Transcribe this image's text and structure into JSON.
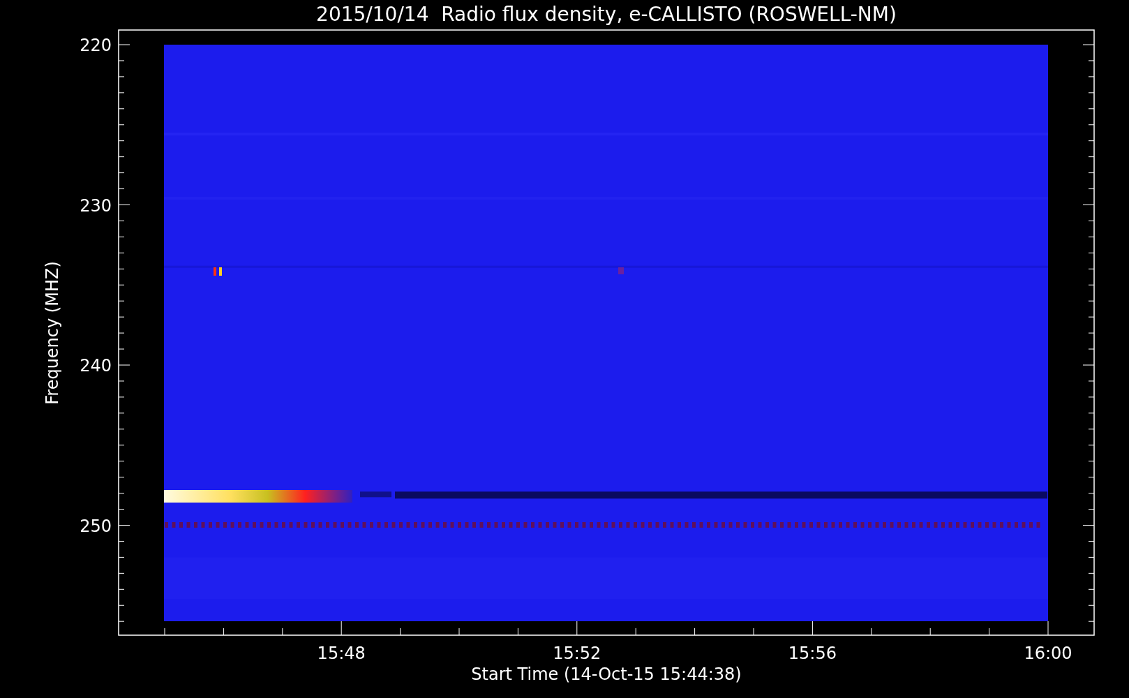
{
  "chart": {
    "title": "2015/10/14  Radio flux density, e-CALLISTO (ROSWELL-NM)",
    "xlabel": "Start Time (14-Oct-15 15:44:38)",
    "ylabel": "Frequency (MHZ)",
    "xticks": [
      "15:48",
      "15:52",
      "15:56",
      "16:00"
    ],
    "yticks": [
      "220",
      "230",
      "240",
      "250"
    ]
  }
}
